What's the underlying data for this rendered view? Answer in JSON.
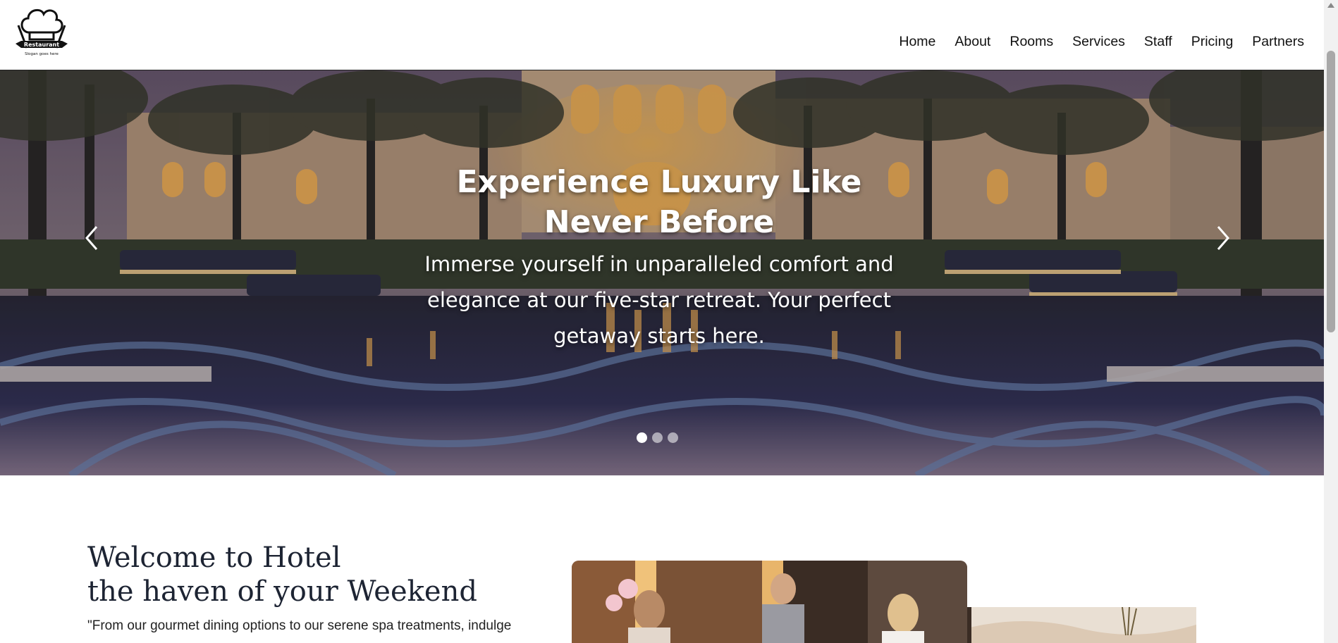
{
  "header": {
    "logo": {
      "name": "chef-hat-logo",
      "text": "Restaurant",
      "slogan": "Slogan goes here"
    },
    "nav": [
      {
        "label": "Home"
      },
      {
        "label": "About"
      },
      {
        "label": "Rooms"
      },
      {
        "label": "Services"
      },
      {
        "label": "Staff"
      },
      {
        "label": "Pricing"
      },
      {
        "label": "Partners"
      }
    ]
  },
  "hero": {
    "title": "Experience Luxury Like Never Before",
    "subtitle": "Immerse yourself in unparalleled comfort and elegance at our five-star retreat. Your perfect getaway starts here.",
    "prev_icon": "chevron-left-icon",
    "next_icon": "chevron-right-icon",
    "slides_count": 3,
    "active_slide": 1
  },
  "welcome": {
    "heading_line1": "Welcome to Hotel",
    "heading_line2": "the haven of your Weekend",
    "text": "\"From our gourmet dining options to our serene spa treatments, indulge"
  },
  "colors": {
    "nav_text": "#111111",
    "heading": "#1d2433",
    "hero_text": "#ffffff"
  }
}
